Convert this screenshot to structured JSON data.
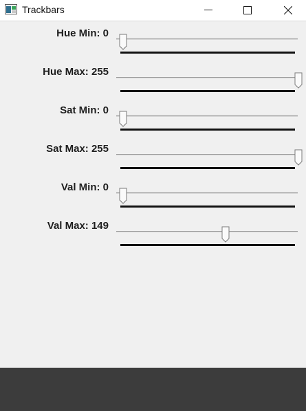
{
  "window": {
    "title": "Trackbars",
    "icon": "opencv-window-icon",
    "controls": [
      "minimize-icon",
      "maximize-icon",
      "close-icon"
    ]
  },
  "trackbars": [
    {
      "name": "Hue Min",
      "label": "Hue Min: 0",
      "value": 0,
      "max": 255
    },
    {
      "name": "Hue Max",
      "label": "Hue Max: 255",
      "value": 255,
      "max": 255
    },
    {
      "name": "Sat Min",
      "label": "Sat Min: 0",
      "value": 0,
      "max": 255
    },
    {
      "name": "Sat Max",
      "label": "Sat Max: 255",
      "value": 255,
      "max": 255
    },
    {
      "name": "Val Min",
      "label": "Val Min: 0",
      "value": 0,
      "max": 255
    },
    {
      "name": "Val Max",
      "label": "Val Max: 149",
      "value": 149,
      "max": 255
    }
  ],
  "colors": {
    "titlebar": "#ffffff",
    "panel": "#f0f0f0",
    "track": "#9a9a9a",
    "underbar": "#111111",
    "bottom": "#3c3c3c"
  }
}
